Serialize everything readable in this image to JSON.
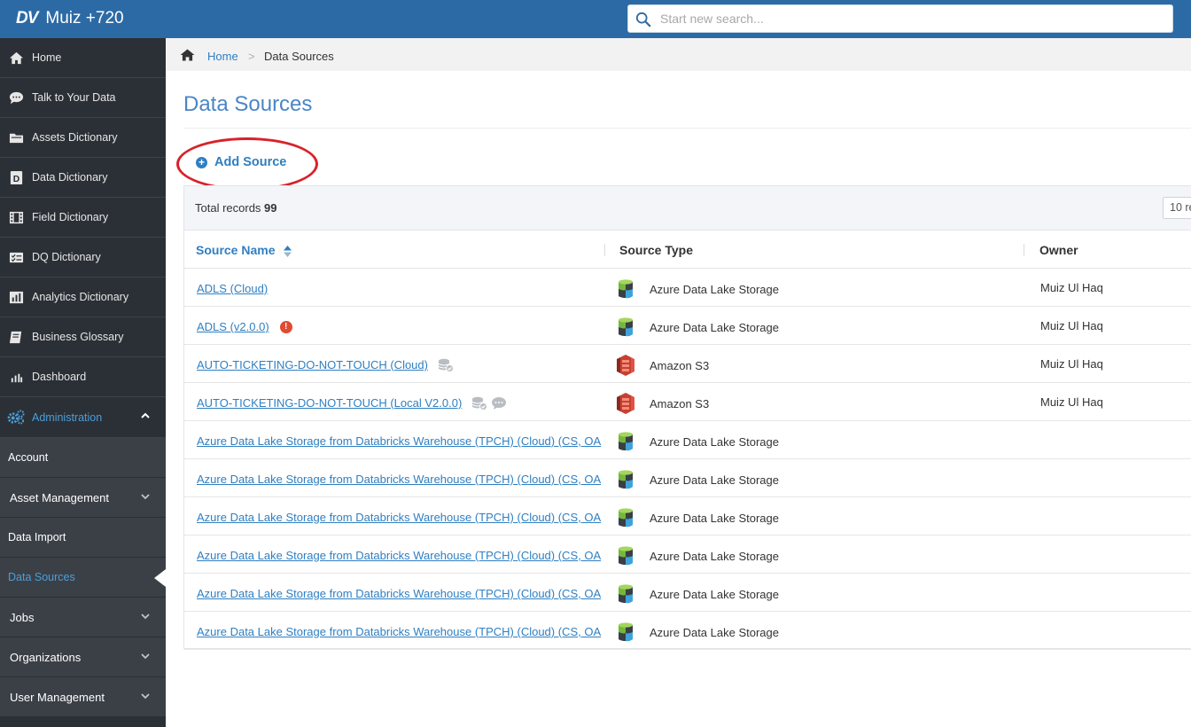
{
  "header": {
    "logo_text": "DV",
    "app_title": "Muiz +720",
    "search_placeholder": "Start new search..."
  },
  "sidebar": {
    "items": [
      {
        "label": "Home",
        "icon": "home-icon"
      },
      {
        "label": "Talk to Your Data",
        "icon": "chat-icon"
      },
      {
        "label": "Assets Dictionary",
        "icon": "folder-icon"
      },
      {
        "label": "Data Dictionary",
        "icon": "data-dictionary-icon"
      },
      {
        "label": "Field Dictionary",
        "icon": "film-icon"
      },
      {
        "label": "DQ Dictionary",
        "icon": "checklist-icon"
      },
      {
        "label": "Analytics Dictionary",
        "icon": "bar-chart-icon"
      },
      {
        "label": "Business Glossary",
        "icon": "book-icon"
      },
      {
        "label": "Dashboard",
        "icon": "dashboard-icon"
      }
    ],
    "admin": {
      "label": "Administration",
      "icon": "cogs-icon"
    },
    "sub_items": [
      {
        "label": "Account"
      },
      {
        "label": "Asset Management"
      },
      {
        "label": "Data Import"
      },
      {
        "label": "Data Sources"
      },
      {
        "label": "Jobs"
      },
      {
        "label": "Organizations"
      },
      {
        "label": "User Management"
      }
    ]
  },
  "breadcrumb": {
    "home": "Home",
    "separator": ">",
    "current": "Data Sources"
  },
  "page": {
    "title": "Data Sources",
    "add_source_label": "Add Source",
    "add_source_icon": "+"
  },
  "table": {
    "total_label": "Total records",
    "total_count": "99",
    "per_page": "10 re",
    "columns": {
      "name": "Source Name",
      "type": "Source Type",
      "owner": "Owner"
    },
    "rows": [
      {
        "name": "ADLS (Cloud)",
        "type": "Azure Data Lake Storage",
        "type_icon": "adls",
        "owner": "Muiz Ul Haq"
      },
      {
        "name": "ADLS (v2.0.0)",
        "type": "Azure Data Lake Storage",
        "type_icon": "adls",
        "owner": "Muiz Ul Haq",
        "warning": "!"
      },
      {
        "name": "AUTO-TICKETING-DO-NOT-TOUCH (Cloud)",
        "type": "Amazon S3",
        "type_icon": "s3",
        "owner": "Muiz Ul Haq"
      },
      {
        "name": "AUTO-TICKETING-DO-NOT-TOUCH (Local V2.0.0)",
        "type": "Amazon S3",
        "type_icon": "s3",
        "owner": "Muiz Ul Haq"
      },
      {
        "name": "Azure Data Lake Storage from Databricks Warehouse (TPCH) (Cloud) (CS, OA",
        "type": "Azure Data Lake Storage",
        "type_icon": "adls",
        "owner": ""
      },
      {
        "name": "Azure Data Lake Storage from Databricks Warehouse (TPCH) (Cloud) (CS, OA",
        "type": "Azure Data Lake Storage",
        "type_icon": "adls",
        "owner": ""
      },
      {
        "name": "Azure Data Lake Storage from Databricks Warehouse (TPCH) (Cloud) (CS, OA",
        "type": "Azure Data Lake Storage",
        "type_icon": "adls",
        "owner": ""
      },
      {
        "name": "Azure Data Lake Storage from Databricks Warehouse (TPCH) (Cloud) (CS, OA",
        "type": "Azure Data Lake Storage",
        "type_icon": "adls",
        "owner": ""
      },
      {
        "name": "Azure Data Lake Storage from Databricks Warehouse (TPCH) (Cloud) (CS, OA",
        "type": "Azure Data Lake Storage",
        "type_icon": "adls",
        "owner": ""
      },
      {
        "name": "Azure Data Lake Storage from Databricks Warehouse (TPCH) (Cloud) (CS, OA",
        "type": "Azure Data Lake Storage",
        "type_icon": "adls",
        "owner": ""
      }
    ]
  },
  "colors": {
    "header_bg": "#2c6aa6",
    "sidebar_bg": "#2b3036",
    "submenu_bg": "#3b4047",
    "link": "#2f7fc1",
    "highlight_ring": "#d8222a",
    "warning": "#e04b32"
  }
}
